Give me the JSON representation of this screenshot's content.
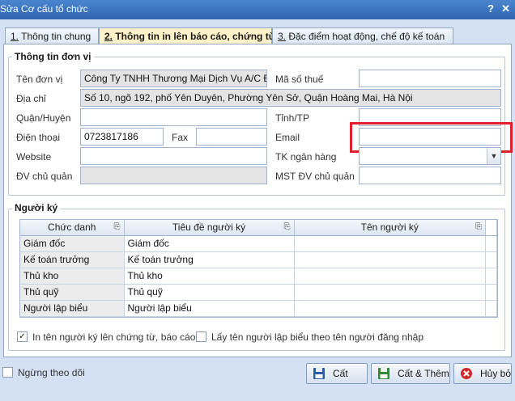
{
  "window": {
    "title": "Sửa Cơ cấu tổ chức",
    "help_glyph": "?",
    "close_glyph": "✕"
  },
  "tabs": [
    {
      "key": "1.",
      "label": " Thông tin chung"
    },
    {
      "key": "2.",
      "label": " Thông tin in lên báo cáo, chứng từ"
    },
    {
      "key": "3.",
      "label": " Đặc điểm hoạt động, chế độ kế toán"
    }
  ],
  "org_info": {
    "group_title": "Thông tin đơn vị",
    "ten_don_vi_label": "Tên đơn vị",
    "ten_don_vi_value": "Công Ty TNHH Thương Mại Dịch Vụ A/C Đạ",
    "ma_so_thue_label": "Mã số thuế",
    "ma_so_thue_value": "",
    "dia_chi_label": "Địa chỉ",
    "dia_chi_value": "Số 10, ngõ 192, phố Yên Duyên, Phường Yên Sở, Quận Hoàng Mai, Hà Nội",
    "quan_huyen_label": "Quận/Huyện",
    "quan_huyen_value": "",
    "tinh_tp_label": "Tỉnh/TP",
    "tinh_tp_value": "",
    "dien_thoai_label": "Điện thoại",
    "dien_thoai_value": "0723817186",
    "fax_label": "Fax",
    "fax_value": "",
    "email_label": "Email",
    "email_value": "",
    "website_label": "Website",
    "website_value": "",
    "tk_ngan_hang_label": "TK ngân hàng",
    "tk_ngan_hang_value": "",
    "dv_chu_quan_label": "ĐV chủ quản",
    "dv_chu_quan_value": "",
    "mst_dv_chu_quan_label": "MST ĐV chủ quản",
    "mst_dv_chu_quan_value": ""
  },
  "signers": {
    "group_title": "Người ký",
    "columns": [
      "Chức danh",
      "Tiêu đề người ký",
      "Tên người ký"
    ],
    "rows": [
      {
        "chuc_danh": "Giám đốc",
        "tieu_de": "Giám đốc",
        "ten": ""
      },
      {
        "chuc_danh": "Kế toán trưởng",
        "tieu_de": "Kế toán trưởng",
        "ten": ""
      },
      {
        "chuc_danh": "Thủ kho",
        "tieu_de": "Thủ kho",
        "ten": ""
      },
      {
        "chuc_danh": "Thủ quỹ",
        "tieu_de": "Thủ quỹ",
        "ten": ""
      },
      {
        "chuc_danh": "Người lập biểu",
        "tieu_de": "Người lập biểu",
        "ten": ""
      }
    ],
    "print_signer_label": "In tên người ký lên chứng từ, báo cáo",
    "print_signer_checked": true,
    "use_login_name_label": "Lấy tên người lập biểu theo tên người đăng nhập",
    "use_login_name_checked": false
  },
  "footer": {
    "stop_tracking_label": "Ngừng theo dõi",
    "stop_tracking_checked": false,
    "save_label": "Cất",
    "save_add_label": "Cất & Thêm",
    "cancel_label": "Hủy bỏ"
  },
  "colors": {
    "highlight_box": "#e0202a",
    "active_tab": "#fff2c8"
  }
}
